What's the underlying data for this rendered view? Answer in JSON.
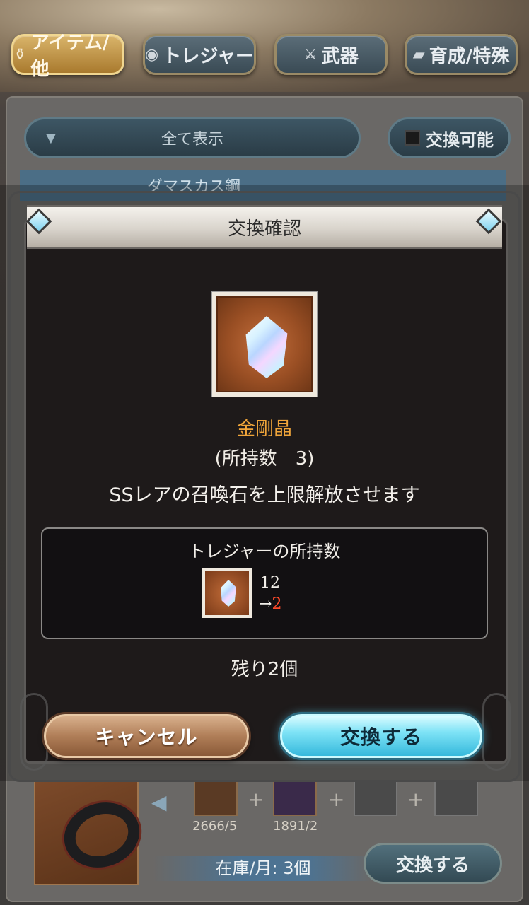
{
  "tabs": [
    {
      "label": "アイテム/他",
      "icon": "potion-icon"
    },
    {
      "label": "トレジャー",
      "icon": "treasure-icon"
    },
    {
      "label": "武器",
      "icon": "sword-icon"
    },
    {
      "label": "育成/特殊",
      "icon": "card-icon"
    }
  ],
  "filter": {
    "label": "全て表示",
    "toggle_label": "交換可能"
  },
  "list_header": "ダマスカス鋼",
  "background_row": {
    "mat1_count": "2666/5",
    "mat2_count": "1891/2",
    "stock": "在庫/月: 3個",
    "exchange_label": "交換する"
  },
  "modal": {
    "title": "交換確認",
    "item_name": "金剛晶",
    "owned": "(所持数　3)",
    "description": "SSレアの召喚石を上限解放させます",
    "treasure_title": "トレジャーの所持数",
    "treasure_before": "12",
    "treasure_arrow": "→",
    "treasure_after": "2",
    "remaining": "残り2個",
    "cancel_label": "キャンセル",
    "confirm_label": "交換する"
  },
  "colors": {
    "item_name": "#f0a53a",
    "after_value": "#ff4a2a",
    "confirm_button": "#36b9dc"
  }
}
